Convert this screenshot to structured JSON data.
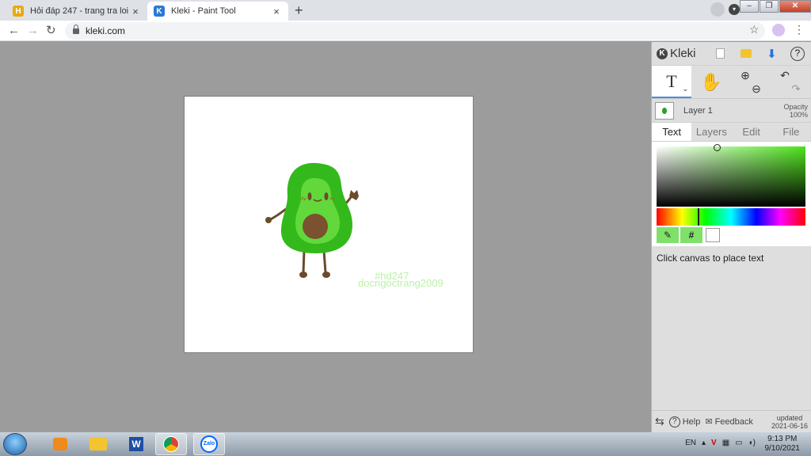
{
  "browser": {
    "tabs": [
      {
        "title": "Hỏi đáp 247 - trang tra loi",
        "favicon": "H"
      },
      {
        "title": "Kleki - Paint Tool",
        "favicon": "K"
      }
    ],
    "new_tab": "+",
    "close_glyph": "×",
    "url": "kleki.com"
  },
  "canvas": {
    "watermark_line1": "#hd247",
    "watermark_line2": "docngoctrang2009"
  },
  "panel": {
    "app_name": "Kleki",
    "layer_name": "Layer 1",
    "opacity_label": "Opacity",
    "opacity_value": "100%",
    "tabs": [
      "Text",
      "Layers",
      "Edit",
      "File"
    ],
    "active_tab": "Text",
    "hash_label": "#",
    "hint": "Click canvas to place text",
    "help": "Help",
    "feedback": "Feedback",
    "updated_label": "updated",
    "updated_date": "2021-06-16"
  },
  "taskbar": {
    "language": "EN",
    "time": "9:13 PM",
    "date": "9/10/2021"
  },
  "colors": {
    "brush_primary": "#4ee31c",
    "avocado_outer": "#33b91b",
    "avocado_inner": "#62d83b",
    "pit": "#7a5230",
    "limb": "#6b4b2a"
  }
}
